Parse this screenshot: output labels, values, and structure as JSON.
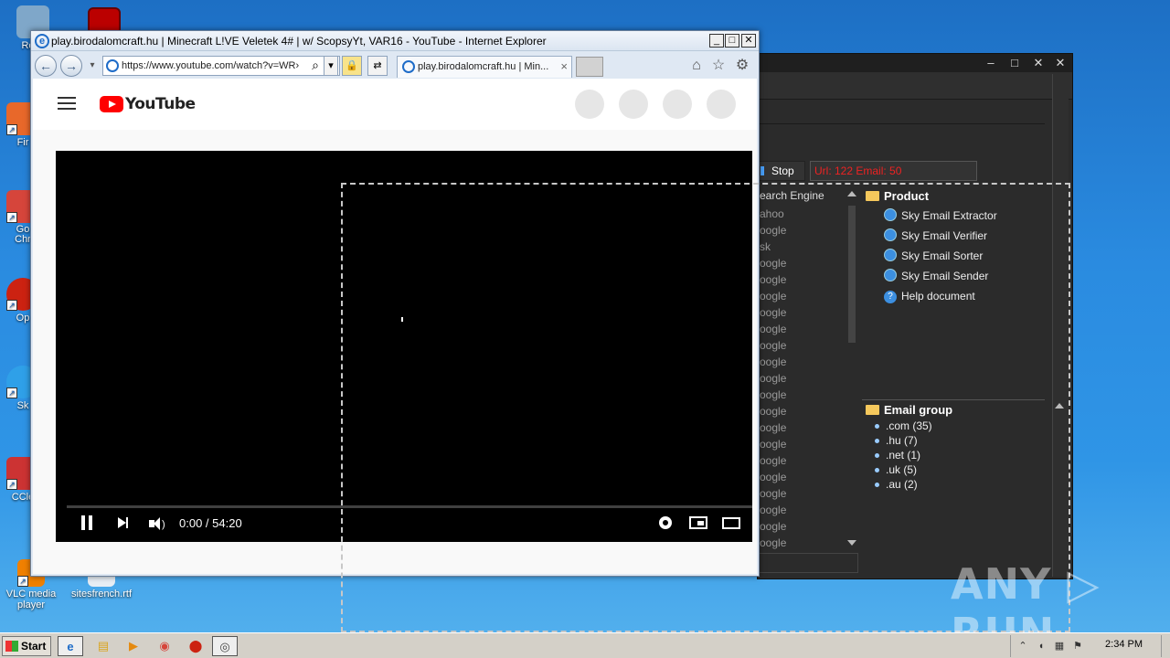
{
  "desktop": {
    "icons": [
      {
        "label": "Recy",
        "color": "#7fa7c9"
      },
      {
        "label": "Fir",
        "color": "#e8682a"
      },
      {
        "label": "Go\nChr",
        "color": "#d6453b"
      },
      {
        "label": "Op",
        "color": "#c21"
      },
      {
        "label": "Sk",
        "color": "#2fa0e8"
      },
      {
        "label": "CCle",
        "color": "#c33"
      }
    ],
    "vlc_label": "VLC media player",
    "rtf_label": "sitesfrench.rtf"
  },
  "sky_app": {
    "stop_label": "Stop",
    "status_text": "Url: 122 Email: 50",
    "engine_header": "earch Engine",
    "engines": [
      "ahoo",
      "oogle",
      "sk",
      "oogle",
      "oogle",
      "oogle",
      "oogle",
      "oogle",
      "oogle",
      "oogle",
      "oogle",
      "oogle",
      "oogle",
      "oogle",
      "oogle",
      "oogle",
      "oogle",
      "oogle",
      "oogle",
      "oogle",
      "oogle",
      "oogle"
    ],
    "product_folder": "Product",
    "products": [
      "Sky Email Extractor",
      "Sky Email Verifier",
      "Sky Email Sorter",
      "Sky Email Sender"
    ],
    "help_label": "Help document",
    "email_group_folder": "Email group",
    "email_groups": [
      ".com (35)",
      ".hu (7)",
      ".net (1)",
      ".uk (5)",
      ".au (2)"
    ],
    "titlebar_controls": [
      "–",
      "□",
      "✕",
      "✕"
    ]
  },
  "ie": {
    "title": "play.birodalomcraft.hu | Minecraft L!VE Veletek 4# | w/ ScopsyYt, VAR16 - YouTube - Internet Explorer",
    "url": "https://www.youtube.com/watch?v=WR›",
    "tab_title": "play.birodalomcraft.hu | Min...",
    "tab_close": "×",
    "title_controls": [
      "_",
      "□",
      "✕"
    ]
  },
  "youtube": {
    "logo_text": "YouTube",
    "time_display": "0:00 / 54:20",
    "progress": 0.0
  },
  "taskbar": {
    "start_label": "Start",
    "clock": "2:34 PM"
  },
  "watermark": "ANY ▷ RUN",
  "colors": {
    "youtube_red": "#ff0000",
    "status_red": "#e22222",
    "sky_bg": "#2b2b2b"
  }
}
